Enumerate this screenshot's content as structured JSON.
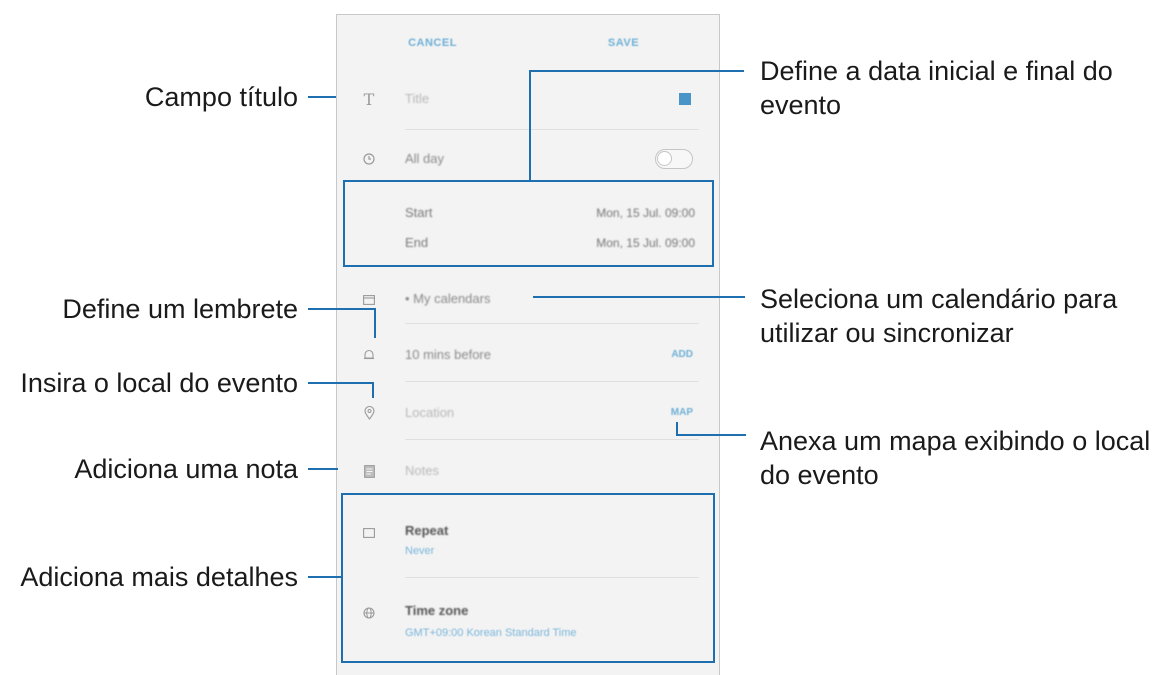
{
  "screen": {
    "top_bar": {
      "cancel_label": "CANCEL",
      "save_label": "SAVE"
    },
    "title": {
      "placeholder": "Title"
    },
    "all_day": {
      "label": "All day",
      "enabled": false
    },
    "start": {
      "label": "Start",
      "value": "Mon, 15 Jul.   09:00"
    },
    "end": {
      "label": "End",
      "value": "Mon, 15 Jul.   09:00"
    },
    "calendar": {
      "label": "• My calendars"
    },
    "reminder": {
      "label": "10 mins before",
      "action": "ADD"
    },
    "location": {
      "placeholder": "Location",
      "action": "MAP"
    },
    "notes": {
      "placeholder": "Notes"
    },
    "repeat": {
      "label": "Repeat",
      "value": "Never"
    },
    "timezone": {
      "label": "Time zone",
      "value": "GMT+09:00 Korean Standard Time"
    }
  },
  "callouts": {
    "title_field": "Campo título",
    "date_range": [
      "Define a data inicial e final do",
      "evento"
    ],
    "reminder": "Define um lembrete",
    "calendar": [
      "Seleciona um calendário para",
      "utilizar ou sincronizar"
    ],
    "location": "Insira o local do evento",
    "map": [
      "Anexa um mapa exibindo o local",
      "do evento"
    ],
    "note": "Adiciona uma nota",
    "details": "Adiciona mais detalhes"
  },
  "colors": {
    "callout_line": "#1d6fb0",
    "accent": "#6fb0d6",
    "color_swatch": "#4a95c7"
  }
}
